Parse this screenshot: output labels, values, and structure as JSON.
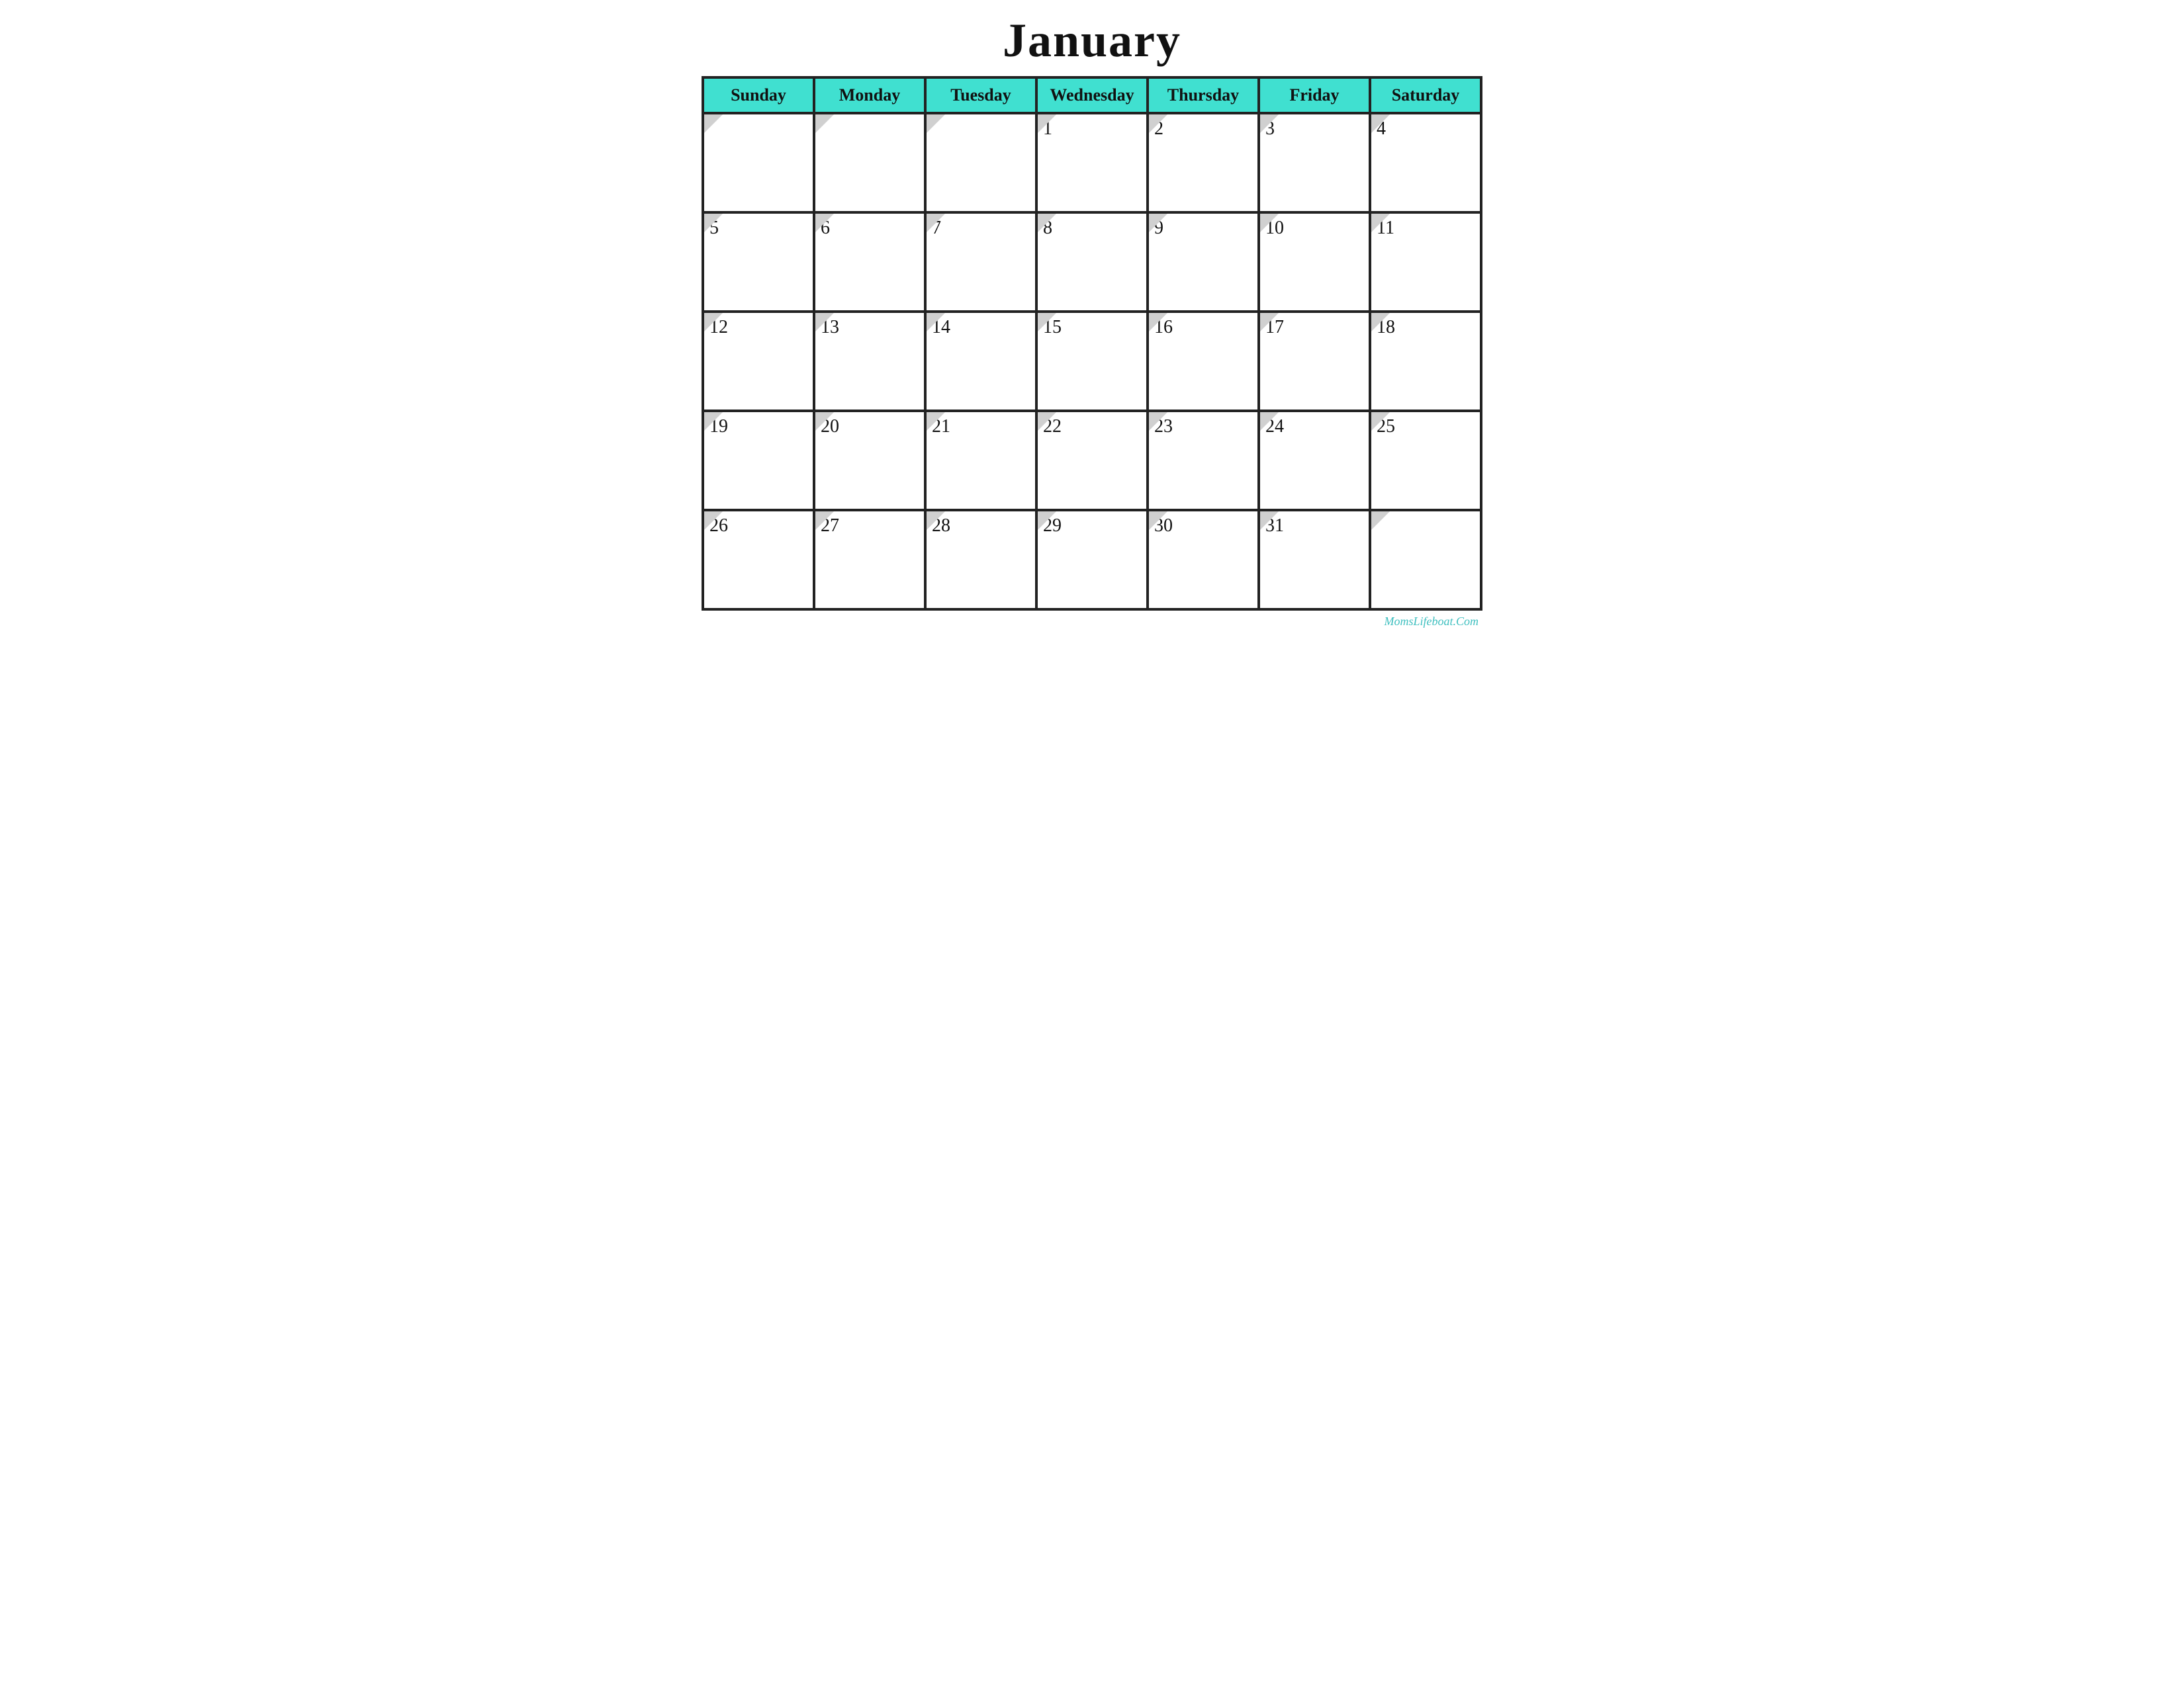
{
  "title": "January",
  "header": {
    "days": [
      "Sunday",
      "Monday",
      "Tuesday",
      "Wednesday",
      "Thursday",
      "Friday",
      "Saturday"
    ]
  },
  "weeks": [
    [
      {
        "date": "",
        "empty": true
      },
      {
        "date": "",
        "empty": true
      },
      {
        "date": "",
        "empty": true
      },
      {
        "date": "1",
        "empty": false
      },
      {
        "date": "2",
        "empty": false
      },
      {
        "date": "3",
        "empty": false
      },
      {
        "date": "4",
        "empty": false
      }
    ],
    [
      {
        "date": "5",
        "empty": false
      },
      {
        "date": "6",
        "empty": false
      },
      {
        "date": "7",
        "empty": false
      },
      {
        "date": "8",
        "empty": false
      },
      {
        "date": "9",
        "empty": false
      },
      {
        "date": "10",
        "empty": false
      },
      {
        "date": "11",
        "empty": false
      }
    ],
    [
      {
        "date": "12",
        "empty": false
      },
      {
        "date": "13",
        "empty": false
      },
      {
        "date": "14",
        "empty": false
      },
      {
        "date": "15",
        "empty": false
      },
      {
        "date": "16",
        "empty": false
      },
      {
        "date": "17",
        "empty": false
      },
      {
        "date": "18",
        "empty": false
      }
    ],
    [
      {
        "date": "19",
        "empty": false
      },
      {
        "date": "20",
        "empty": false
      },
      {
        "date": "21",
        "empty": false
      },
      {
        "date": "22",
        "empty": false
      },
      {
        "date": "23",
        "empty": false
      },
      {
        "date": "24",
        "empty": false
      },
      {
        "date": "25",
        "empty": false
      }
    ],
    [
      {
        "date": "26",
        "empty": false
      },
      {
        "date": "27",
        "empty": false
      },
      {
        "date": "28",
        "empty": false
      },
      {
        "date": "29",
        "empty": false
      },
      {
        "date": "30",
        "empty": false
      },
      {
        "date": "31",
        "empty": false
      },
      {
        "date": "",
        "empty": true
      }
    ]
  ],
  "watermark": "MomsLifeboat.Com",
  "colors": {
    "header_bg": "#40e0d0",
    "border": "#222222",
    "corner_fold": "#d0d0d0",
    "watermark": "#40c0c0"
  }
}
